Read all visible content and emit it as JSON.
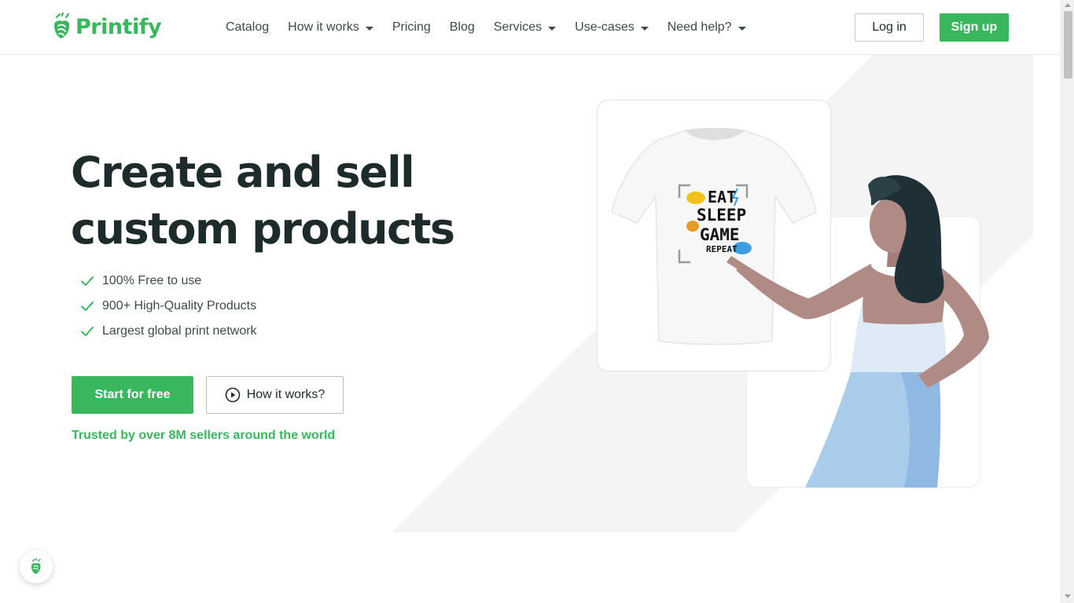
{
  "brand": {
    "name": "Printify",
    "color": "#39b75d"
  },
  "nav": {
    "items": [
      {
        "label": "Catalog",
        "dropdown": false
      },
      {
        "label": "How it works",
        "dropdown": true
      },
      {
        "label": "Pricing",
        "dropdown": false
      },
      {
        "label": "Blog",
        "dropdown": false
      },
      {
        "label": "Services",
        "dropdown": true
      },
      {
        "label": "Use-cases",
        "dropdown": true
      },
      {
        "label": "Need help?",
        "dropdown": true
      }
    ],
    "login_label": "Log in",
    "signup_label": "Sign up"
  },
  "hero": {
    "title_line1": "Create and sell",
    "title_line2": "custom products",
    "features": [
      "100% Free to use",
      "900+ High-Quality Products",
      "Largest global print network"
    ],
    "start_label": "Start for free",
    "how_label": "How it works?",
    "trusted_text": "Trusted by over 8M sellers around the world"
  },
  "tshirt_print": {
    "line1": "EAT",
    "line2": "SLEEP",
    "line3": "GAME",
    "line4": "REPEAT"
  },
  "icons": {
    "check": "check-icon",
    "play": "play-circle-icon",
    "logo": "printify-logo-icon",
    "chat": "chat-icon"
  }
}
